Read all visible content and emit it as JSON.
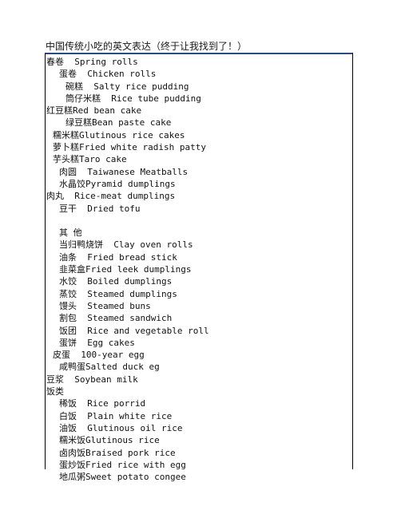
{
  "document": {
    "title": "中国传统小吃的英文表达（终于让我找到了！）",
    "colors": {
      "top_border": "#2b4a7d",
      "side_border": "#000000",
      "text": "#111111",
      "background": "#ffffff"
    },
    "entries": [
      {
        "text": "春卷  Spring rolls",
        "indent": 0
      },
      {
        "text": "蛋卷  Chicken rolls",
        "indent": 2
      },
      {
        "text": "碗糕  Salty rice pudding",
        "indent": 3
      },
      {
        "text": "筒仔米糕  Rice tube pudding",
        "indent": 3
      },
      {
        "text": "红豆糕Red bean cake",
        "indent": 0
      },
      {
        "text": "绿豆糕Bean paste cake",
        "indent": 3
      },
      {
        "text": "糯米糕Glutinous rice cakes",
        "indent": 1
      },
      {
        "text": "萝卜糕Fried white radish patty",
        "indent": 1
      },
      {
        "text": "芋头糕Taro cake",
        "indent": 1
      },
      {
        "text": "肉圆  Taiwanese Meatballs",
        "indent": 2
      },
      {
        "text": "水晶饺Pyramid dumplings",
        "indent": 2
      },
      {
        "text": "肉丸  Rice-meat dumplings",
        "indent": 0
      },
      {
        "text": "豆干  Dried tofu",
        "indent": 2
      },
      {
        "text": "",
        "indent": 0
      },
      {
        "text": "其 他",
        "indent": 2
      },
      {
        "text": "当归鸭烧饼  Clay oven rolls",
        "indent": 2
      },
      {
        "text": "油条  Fried bread stick",
        "indent": 2
      },
      {
        "text": "韭菜盒Fried leek dumplings",
        "indent": 2
      },
      {
        "text": "水饺  Boiled dumplings",
        "indent": 2
      },
      {
        "text": "蒸饺  Steamed dumplings",
        "indent": 2
      },
      {
        "text": "馒头  Steamed buns",
        "indent": 2
      },
      {
        "text": "割包  Steamed sandwich",
        "indent": 2
      },
      {
        "text": "饭团  Rice and vegetable roll",
        "indent": 2
      },
      {
        "text": "蛋饼  Egg cakes",
        "indent": 2
      },
      {
        "text": "皮蛋  100-year egg",
        "indent": 1
      },
      {
        "text": "咸鸭蛋Salted duck eg",
        "indent": 2
      },
      {
        "text": "豆浆  Soybean milk",
        "indent": 0
      },
      {
        "text": "饭类",
        "indent": 0
      },
      {
        "text": "稀饭  Rice porrid",
        "indent": 2
      },
      {
        "text": "白饭  Plain white rice",
        "indent": 2
      },
      {
        "text": "油饭  Glutinous oil rice",
        "indent": 2
      },
      {
        "text": "糯米饭Glutinous rice",
        "indent": 2
      },
      {
        "text": "卤肉饭Braised pork rice",
        "indent": 2
      },
      {
        "text": "蛋炒饭Fried rice with egg",
        "indent": 2
      },
      {
        "text": "地瓜粥Sweet potato congee",
        "indent": 2
      }
    ]
  }
}
